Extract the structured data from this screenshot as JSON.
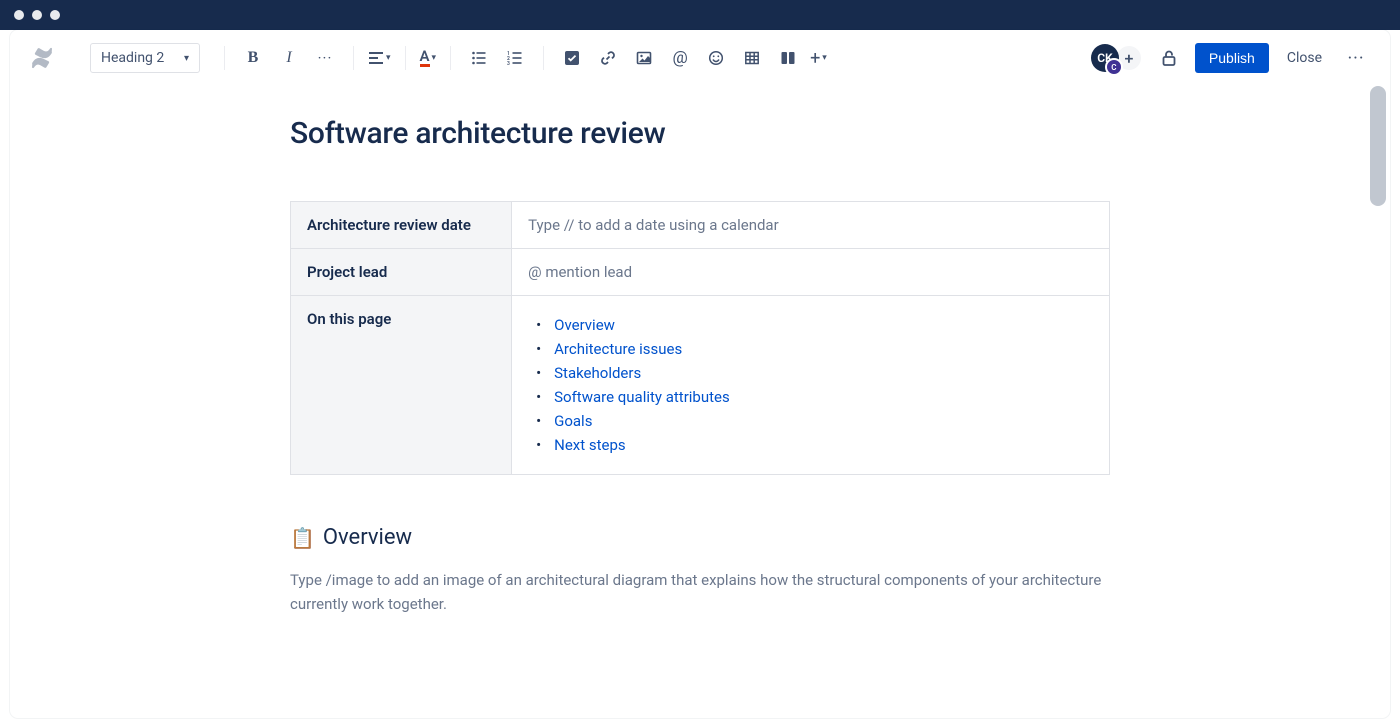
{
  "titlebar": {
    "dots": 3
  },
  "toolbar": {
    "text_style": "Heading 2",
    "avatar_initials": "CK",
    "avatar_mini": "C",
    "publish_label": "Publish",
    "close_label": "Close"
  },
  "page": {
    "title": "Software architecture review",
    "meta": {
      "row1_label": "Architecture review date",
      "row1_value": "Type // to add a date using a calendar",
      "row2_label": "Project lead",
      "row2_value": "@ mention lead",
      "row3_label": "On this page"
    },
    "toc": [
      "Overview",
      "Architecture issues",
      "Stakeholders",
      "Software quality attributes",
      "Goals",
      "Next steps"
    ],
    "section_overview": {
      "emoji": "📋",
      "title": "Overview",
      "body": "Type /image to add an image of an architectural diagram that explains how the structural components of your architecture currently work together."
    }
  }
}
